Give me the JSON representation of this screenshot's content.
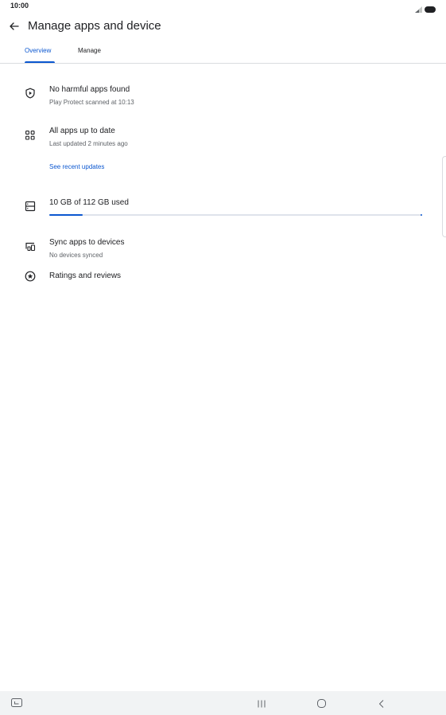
{
  "status_bar": {
    "time": "10:00",
    "icons": [
      "signal-icon",
      "battery-icon"
    ]
  },
  "app_bar": {
    "back_icon": "arrow-back-icon",
    "title": "Manage apps and device"
  },
  "tabs": [
    {
      "label": "Overview",
      "selected": true
    },
    {
      "label": "Manage",
      "selected": false
    }
  ],
  "overview": {
    "protect": {
      "icon": "play-protect-icon",
      "title": "No harmful apps found",
      "subtitle": "Play Protect scanned at 10:13"
    },
    "updates": {
      "icon": "apps-grid-icon",
      "title": "All apps up to date",
      "subtitle": "Last updated 2 minutes ago",
      "link": "See recent updates"
    },
    "storage": {
      "icon": "storage-icon",
      "title": "10 GB of 112 GB used",
      "used_gb": 10,
      "total_gb": 112
    },
    "sync": {
      "icon": "devices-icon",
      "title": "Sync apps to devices",
      "subtitle": "No devices synced"
    },
    "ratings": {
      "icon": "star-circle-icon",
      "title": "Ratings and reviews"
    }
  },
  "nav_bar": {
    "icons": [
      "keyboard-icon",
      "recent-apps-icon",
      "home-icon",
      "back-icon"
    ]
  },
  "colors": {
    "accent": "#0b57d0",
    "text_primary": "#202124",
    "text_secondary": "#5f6368",
    "divider": "#dadce0",
    "nav_background": "#f1f3f4"
  }
}
